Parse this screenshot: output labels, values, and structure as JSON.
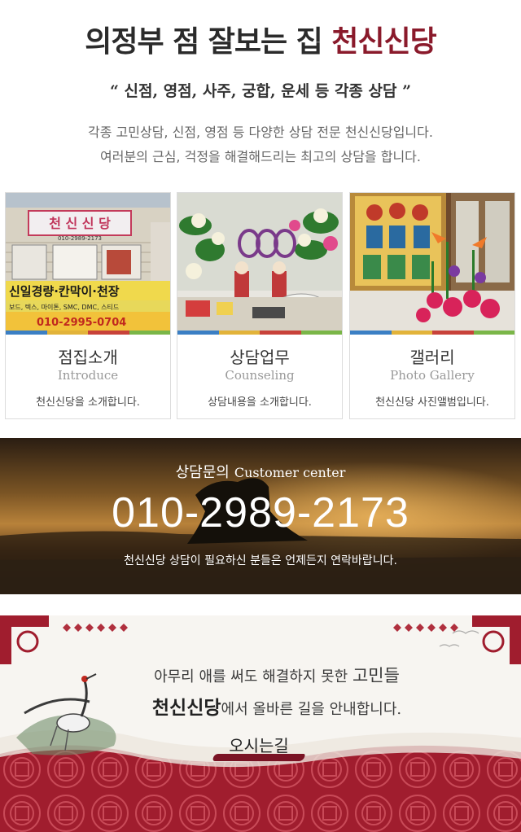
{
  "header": {
    "title_main": "의정부 점 잘보는 집 ",
    "title_accent": "천신신당",
    "subtitle": "“ 신점, 영점, 사주, 궁합, 운세 등 각종 상담 ”",
    "desc_line1": "각종 고민상담, 신점, 영점 등 다양한 상담 전문 천신신당입니다.",
    "desc_line2": "여러분의 근심, 걱정을 해결해드리는 최고의 상담을 합니다."
  },
  "cards": [
    {
      "title": "점집소개",
      "subtitle_en": "Introduce",
      "desc": "천신신당을 소개합니다.",
      "photo_text": {
        "sign": "천 신 신 당",
        "sign_phone": "010-2989-2173",
        "shop_banner": "신일경량·칸막이·천장",
        "shop_sub": "보드, 텍스, 마이톤, SMC, DMC, 스티드",
        "shop_phone": "010-2995-0704"
      }
    },
    {
      "title": "상담업무",
      "subtitle_en": "Counseling",
      "desc": "상담내용을 소개합니다."
    },
    {
      "title": "갤러리",
      "subtitle_en": "Photo Gallery",
      "desc": "천신신당 사진앨범입니다."
    }
  ],
  "stripe_colors": [
    "#3b7fc4",
    "#e2b33a",
    "#c8423a",
    "#7ab648"
  ],
  "contact": {
    "label_ko": "상담문의",
    "label_en": "Customer center",
    "phone": "010-2989-2173",
    "note": "천신신당 상담이 필요하신 분들은 언제든지 연락바랍니다."
  },
  "banner": {
    "line1_normal": "아무리 애를 써도 해결하지 못한 ",
    "line1_strong": "고민들",
    "line2_strong": "천신신당",
    "line2_normal": "에서 올바른 길을 안내합니다.",
    "button_label": "오시는길"
  },
  "colors": {
    "accent": "#8a1a2b",
    "brush": "#7a1324",
    "banner_pattern": "#a01d2e"
  }
}
